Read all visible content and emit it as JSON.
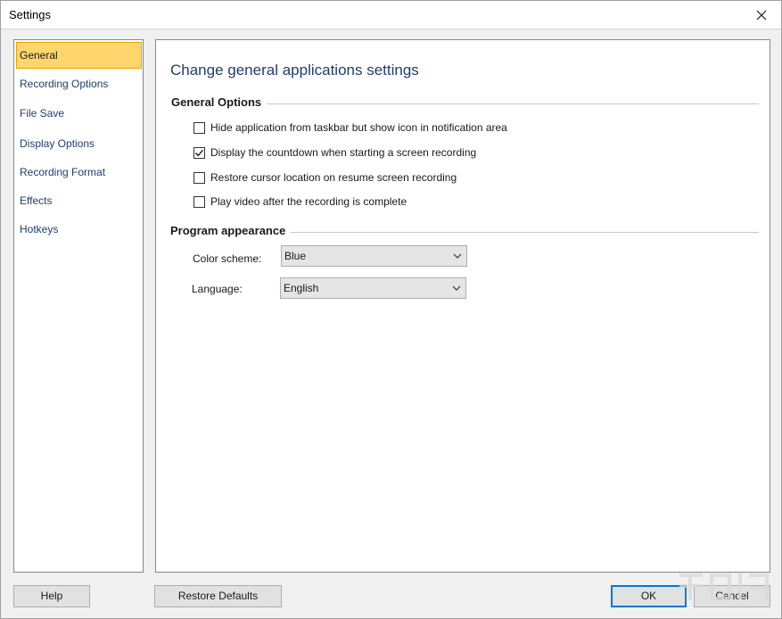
{
  "window": {
    "title": "Settings"
  },
  "nav": {
    "items": [
      {
        "label": "General",
        "selected": true
      },
      {
        "label": "Recording Options",
        "selected": false
      },
      {
        "label": "File Save",
        "selected": false
      },
      {
        "label": "Display Options",
        "selected": false
      },
      {
        "label": "Recording Format",
        "selected": false
      },
      {
        "label": "Effects",
        "selected": false
      },
      {
        "label": "Hotkeys",
        "selected": false
      }
    ]
  },
  "content": {
    "heading": "Change general applications settings",
    "general_options": {
      "title": "General Options",
      "checkboxes": [
        {
          "label": "Hide application from taskbar but show icon in notification area",
          "checked": false
        },
        {
          "label": "Display the countdown when starting a screen recording",
          "checked": true
        },
        {
          "label": "Restore cursor location on resume screen recording",
          "checked": false
        },
        {
          "label": "Play video after the recording is complete",
          "checked": false
        }
      ]
    },
    "appearance": {
      "title": "Program appearance",
      "color_scheme_label": "Color scheme:",
      "color_scheme_value": "Blue",
      "language_label": "Language:",
      "language_value": "English"
    }
  },
  "buttons": {
    "help": "Help",
    "restore_defaults": "Restore Defaults",
    "ok": "OK",
    "cancel": "Cancel"
  },
  "colors": {
    "accent": "#1f3e6d",
    "selected_bg": "#ffd66e",
    "selected_border": "#e6a400",
    "focus_border": "#0078d7"
  },
  "icons": {
    "close": "close-icon",
    "check": "check-icon",
    "dropdown": "chevron-down-icon"
  }
}
